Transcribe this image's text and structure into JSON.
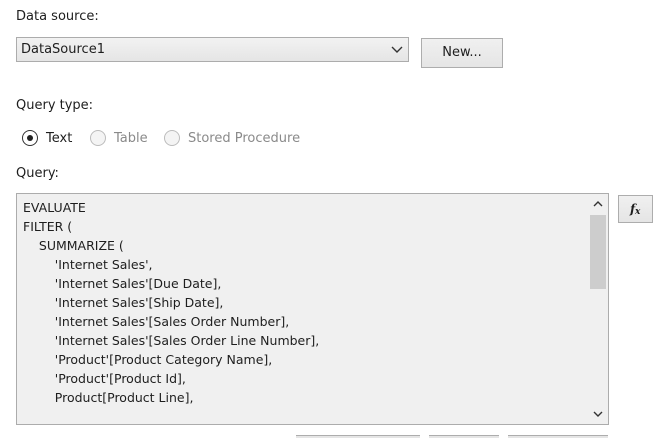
{
  "datasource": {
    "label": "Data source:",
    "selected": "DataSource1",
    "new_button": "New..."
  },
  "query_type": {
    "label": "Query type:",
    "options": [
      {
        "label": "Text",
        "checked": true,
        "enabled": true
      },
      {
        "label": "Table",
        "checked": false,
        "enabled": false
      },
      {
        "label": "Stored Procedure",
        "checked": false,
        "enabled": false
      }
    ]
  },
  "query": {
    "label": "Query:",
    "text": "EVALUATE\nFILTER (\n    SUMMARIZE (\n        'Internet Sales',\n        'Internet Sales'[Due Date],\n        'Internet Sales'[Ship Date],\n        'Internet Sales'[Sales Order Number],\n        'Internet Sales'[Sales Order Line Number],\n        'Product'[Product Category Name],\n        'Product'[Product Id],\n        Product[Product Line],",
    "expression_button": "fx",
    "scroll_position": 0.0
  },
  "icons": {
    "combo_arrow": "chevron-down-icon",
    "scroll_up": "chevron-up-icon",
    "scroll_down": "chevron-down-icon",
    "expression": "function-fx-icon"
  }
}
